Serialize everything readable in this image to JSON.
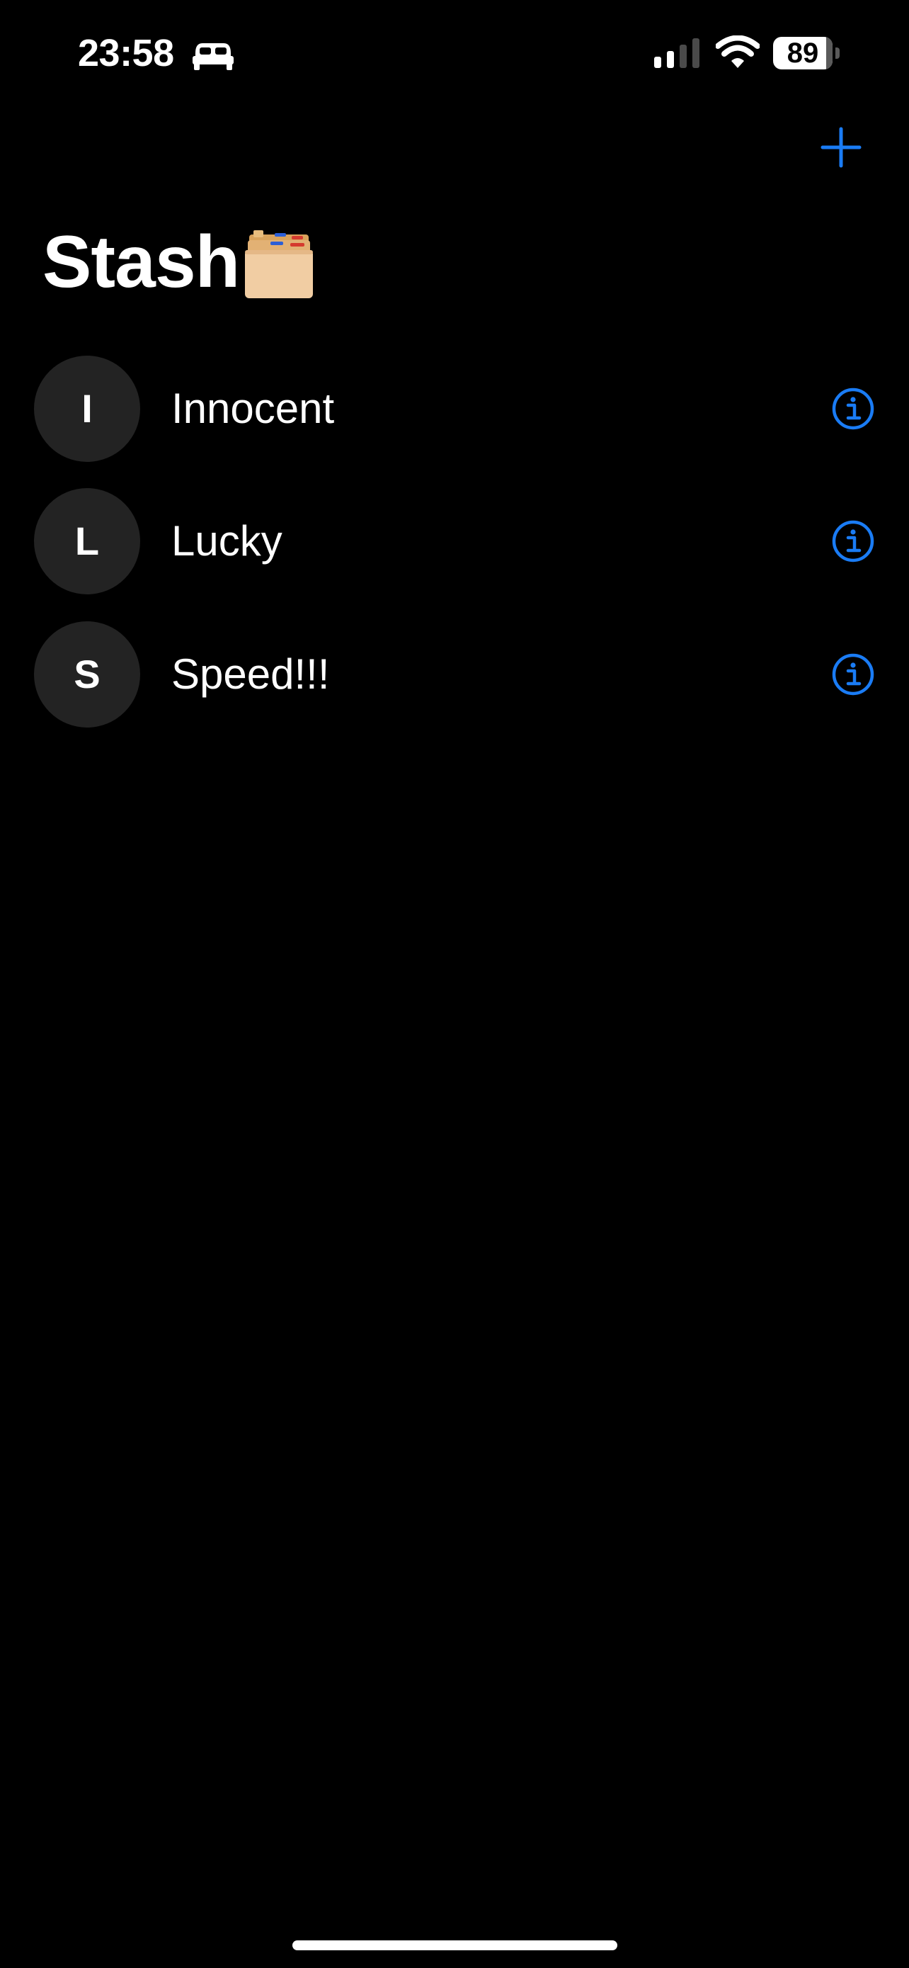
{
  "status_bar": {
    "time": "23:58",
    "sleep_icon": "bed-icon",
    "signal_icon": "cellular-signal-icon",
    "wifi_icon": "wifi-icon",
    "battery_level": "89",
    "battery_fraction": 0.89
  },
  "nav": {
    "add_icon": "plus-icon"
  },
  "page": {
    "title": "Stash",
    "title_icon": "card-file-box-icon"
  },
  "items": [
    {
      "initial": "I",
      "label": "Innocent",
      "info_icon": "info-icon"
    },
    {
      "initial": "L",
      "label": "Lucky",
      "info_icon": "info-icon"
    },
    {
      "initial": "S",
      "label": "Speed!!!",
      "info_icon": "info-icon"
    }
  ],
  "colors": {
    "background": "#000000",
    "accent": "#1a7cf5",
    "avatar_bg": "#232323",
    "text": "#ffffff"
  }
}
